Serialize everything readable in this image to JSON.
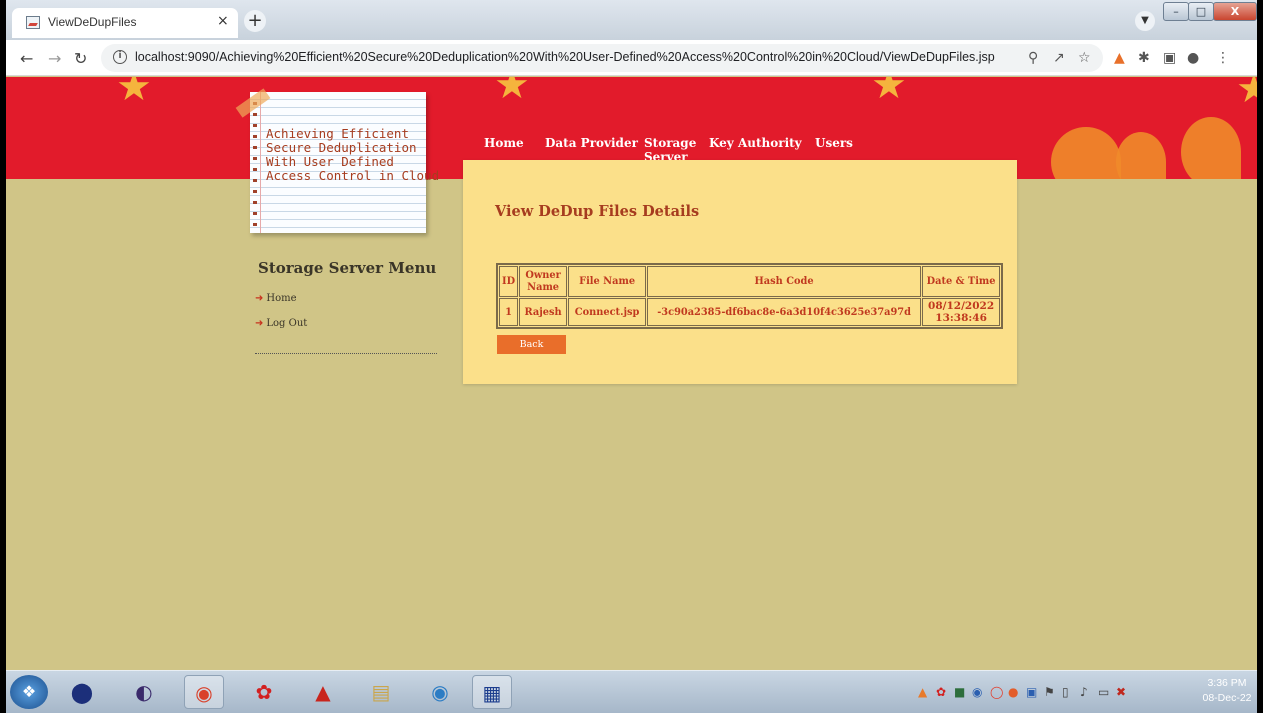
{
  "browser": {
    "tab_title": "ViewDeDupFiles",
    "tab_close": "×",
    "new_tab": "+",
    "url": "localhost:9090/Achieving%20Efficient%20Secure%20Deduplication%20With%20User-Defined%20Access%20Control%20in%20Cloud/ViewDeDupFiles.jsp",
    "window_controls": {
      "minimize": "–",
      "maximize": "□",
      "close": "X"
    }
  },
  "site": {
    "logo_text": "Achieving Efficient\nSecure Deduplication\nWith User Defined\nAccess Control in Cloud",
    "nav": [
      "Home",
      "Data Provider",
      "Storage Server",
      "Key Authority",
      "Users"
    ]
  },
  "sidebar": {
    "title": "Storage Server Menu",
    "links": [
      "Home",
      "Log Out"
    ]
  },
  "main": {
    "heading": "View DeDup Files Details",
    "table": {
      "headers": [
        "ID",
        "Owner Name",
        "File Name",
        "Hash Code",
        "Date & Time"
      ],
      "rows": [
        [
          "1",
          "Rajesh",
          "Connect.jsp",
          "-3c90a2385-df6bac8e-6a3d10f4c3625e37a97d",
          "08/12/2022 13:38:46"
        ]
      ]
    },
    "back_label": "Back"
  },
  "taskbar": {
    "time": "3:36 PM",
    "date": "08-Dec-22"
  },
  "colors": {
    "banner": "#e21b2b",
    "page_bg": "#d0c587",
    "panel_bg": "#fbe08a",
    "heading": "#a63c1f",
    "button": "#e96e2a"
  }
}
